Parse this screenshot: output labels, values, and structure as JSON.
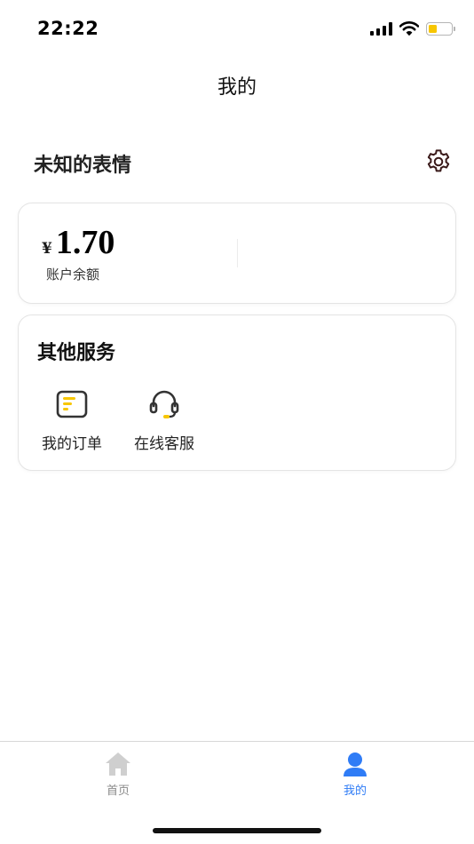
{
  "status_bar": {
    "time": "22:22",
    "icons": [
      "cellular-signal-icon",
      "wifi-icon",
      "battery-icon"
    ],
    "battery_color": "#f7c600"
  },
  "nav": {
    "title": "我的"
  },
  "profile": {
    "name": "未知的表情",
    "settings_icon": "gear-icon",
    "settings_icon_color": "#3a1a1a"
  },
  "balance": {
    "currency_symbol": "¥",
    "amount": "1.70",
    "label": "账户余额"
  },
  "services": {
    "title": "其他服务",
    "items": [
      {
        "label": "我的订单",
        "icon": "order-list-icon"
      },
      {
        "label": "在线客服",
        "icon": "headset-icon"
      }
    ],
    "accent_color": "#f7c600"
  },
  "tab_bar": {
    "tabs": [
      {
        "label": "首页",
        "icon": "home-icon",
        "active": false
      },
      {
        "label": "我的",
        "icon": "user-icon",
        "active": true
      }
    ],
    "active_color": "#2f7cf6",
    "inactive_color": "#8a8a8a"
  }
}
